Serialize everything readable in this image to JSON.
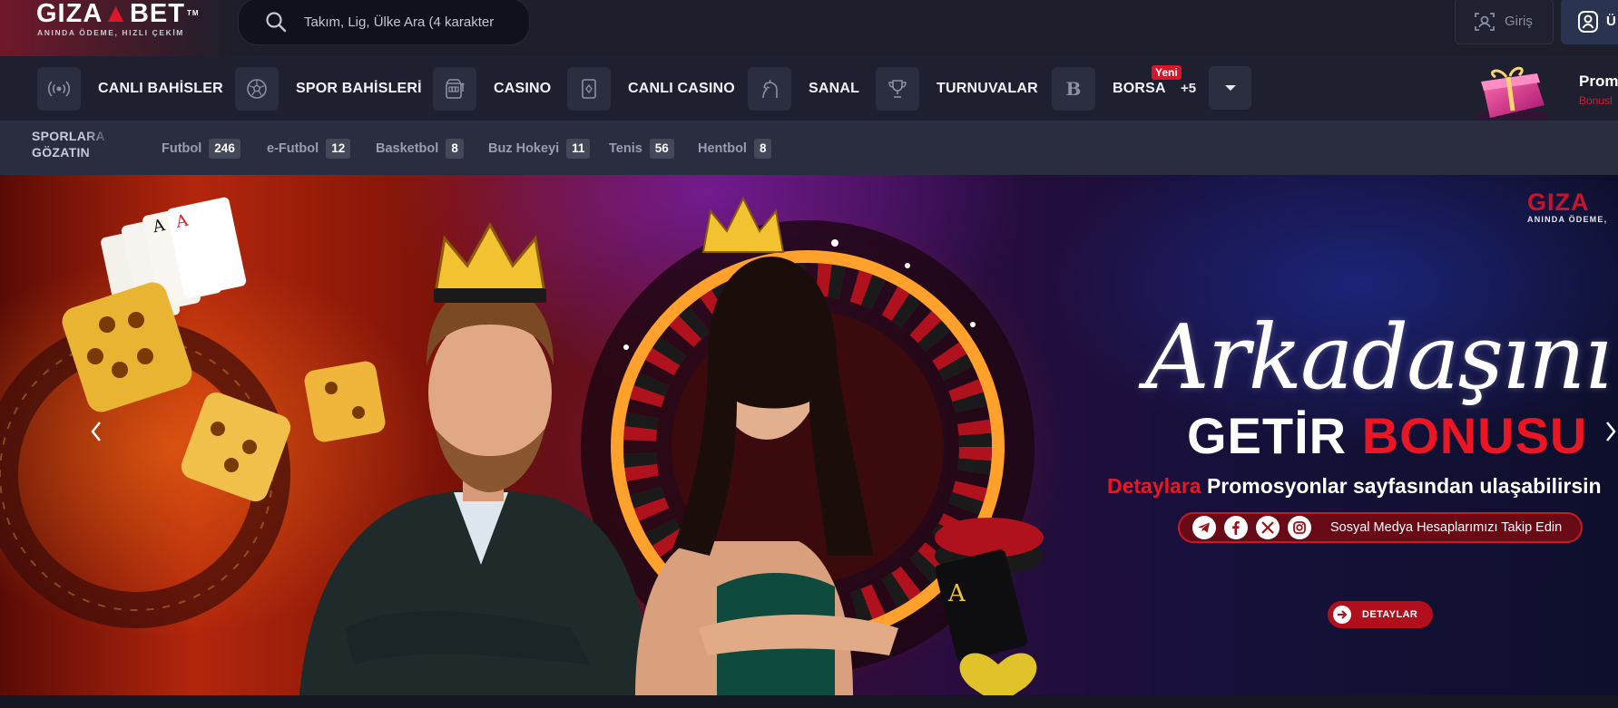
{
  "header": {
    "logo": {
      "part1": "GIZA",
      "part2": "BET",
      "tm": "TM",
      "tagline": "ANINDA ÖDEME, HIZLI ÇEKİM"
    },
    "search": {
      "placeholder": "Takım, Lig, Ülke Ara (4 karakter",
      "icon": "search-icon"
    },
    "login_label": "Giriş",
    "signup_label": "Ü"
  },
  "nav": {
    "items": [
      {
        "label": "CANLI BAHİSLER",
        "icon": "live-signal-icon"
      },
      {
        "label": "SPOR BAHİSLERİ",
        "icon": "soccer-ball-icon"
      },
      {
        "label": "CASINO",
        "icon": "slot-machine-icon"
      },
      {
        "label": "CANLI CASINO",
        "icon": "playing-card-icon"
      },
      {
        "label": "SANAL",
        "icon": "horse-icon"
      },
      {
        "label": "TURNUVALAR",
        "icon": "trophy-icon"
      },
      {
        "label": "BORSA",
        "icon": "borsa-b-icon",
        "badge": "Yeni",
        "icon_letter": "B"
      }
    ],
    "more_count": "+5",
    "promo": {
      "title": "Prom",
      "subtitle": "Bonusl"
    }
  },
  "sports": {
    "title_line1": "SPORLARA",
    "title_line2": "GÖZATIN",
    "items": [
      {
        "name": "Futbol",
        "count": "246"
      },
      {
        "name": "e-Futbol",
        "count": "12"
      },
      {
        "name": "Basketbol",
        "count": "8"
      },
      {
        "name": "Buz Hokeyi",
        "count": "11"
      },
      {
        "name": "Tenis",
        "count": "56"
      },
      {
        "name": "Hentbol",
        "count": "8"
      }
    ]
  },
  "banner": {
    "logo_main": "GIZA",
    "logo_sub": "ANINDA ÖDEME,",
    "script_title": "Arkadaşını",
    "title_white": "GETİR",
    "title_red": "BONUSU",
    "details_red": "Detaylara",
    "details_white": "Promosyonlar sayfasından ulaşabilirsin",
    "social_text": "Sosyal Medya Hesaplarımızı Takip Edin",
    "social_icons": [
      "telegram-icon",
      "facebook-icon",
      "x-twitter-icon",
      "instagram-icon"
    ],
    "button_label": "DETAYLAR"
  },
  "colors": {
    "accent_red": "#e0162b",
    "header_bg": "#1c1e2b",
    "nav_bg": "#1e2030",
    "sports_bg": "#2a2d40"
  }
}
